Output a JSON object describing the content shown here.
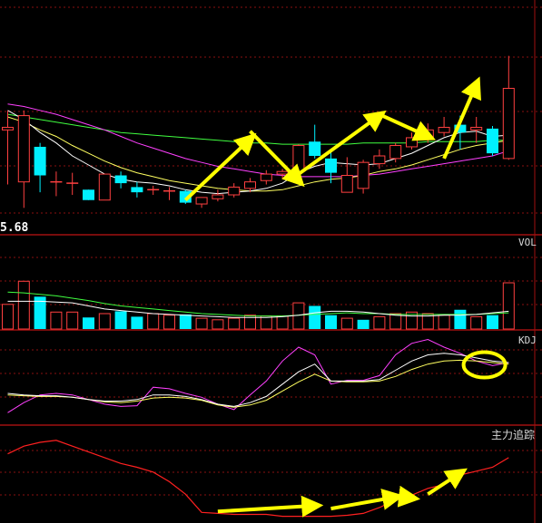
{
  "colors": {
    "background": "#000000",
    "up": "#ff4040",
    "down": "#00f0ff",
    "grid": "#8a1010",
    "divider": "#a01010",
    "ma5": "#ffffff",
    "ma10": "#ffff60",
    "ma20": "#ff40ff",
    "ma60": "#40ff40",
    "k": "#ffffff",
    "d": "#ffff60",
    "j": "#ff40ff",
    "tracker": "#ff2020",
    "arrow": "#ffff00",
    "circle": "#ffff00",
    "doji": "#ff4040"
  },
  "panels": {
    "main": {
      "price_label": "5.68"
    },
    "volume": {
      "label": "VOL"
    },
    "kdj": {
      "label": "KDJ"
    },
    "tracker": {
      "label": "主力追踪"
    }
  },
  "chart_data": [
    {
      "type": "candlestick",
      "panel": "main",
      "price_label": "5.68",
      "ylim": [
        5.4,
        7.2
      ],
      "candles": [
        {
          "o": 6.2,
          "h": 6.35,
          "l": 5.78,
          "c": 6.22,
          "dir": "up"
        },
        {
          "o": 6.31,
          "h": 6.35,
          "l": 5.6,
          "c": 5.8,
          "dir": "up"
        },
        {
          "o": 6.07,
          "h": 6.1,
          "l": 5.72,
          "c": 5.85,
          "dir": "down"
        },
        {
          "o": 5.8,
          "h": 5.88,
          "l": 5.69,
          "c": 5.8,
          "dir": "doji"
        },
        {
          "o": 5.79,
          "h": 5.87,
          "l": 5.7,
          "c": 5.79,
          "dir": "doji"
        },
        {
          "o": 5.74,
          "h": 5.74,
          "l": 5.66,
          "c": 5.66,
          "dir": "down"
        },
        {
          "o": 5.66,
          "h": 5.86,
          "l": 5.66,
          "c": 5.86,
          "dir": "up"
        },
        {
          "o": 5.85,
          "h": 5.88,
          "l": 5.75,
          "c": 5.79,
          "dir": "down"
        },
        {
          "o": 5.76,
          "h": 5.8,
          "l": 5.68,
          "c": 5.72,
          "dir": "down"
        },
        {
          "o": 5.74,
          "h": 5.77,
          "l": 5.7,
          "c": 5.74,
          "dir": "doji"
        },
        {
          "o": 5.73,
          "h": 5.76,
          "l": 5.66,
          "c": 5.7,
          "dir": "doji"
        },
        {
          "o": 5.73,
          "h": 5.74,
          "l": 5.63,
          "c": 5.64,
          "dir": "down"
        },
        {
          "o": 5.63,
          "h": 5.68,
          "l": 5.6,
          "c": 5.68,
          "dir": "up"
        },
        {
          "o": 5.67,
          "h": 5.74,
          "l": 5.65,
          "c": 5.7,
          "dir": "up"
        },
        {
          "o": 5.7,
          "h": 5.79,
          "l": 5.68,
          "c": 5.76,
          "dir": "up"
        },
        {
          "o": 5.75,
          "h": 5.83,
          "l": 5.72,
          "c": 5.8,
          "dir": "up"
        },
        {
          "o": 5.81,
          "h": 5.89,
          "l": 5.78,
          "c": 5.86,
          "dir": "up"
        },
        {
          "o": 5.86,
          "h": 5.9,
          "l": 5.82,
          "c": 5.88,
          "dir": "up"
        },
        {
          "o": 5.88,
          "h": 6.09,
          "l": 5.85,
          "c": 6.08,
          "dir": "up"
        },
        {
          "o": 6.11,
          "h": 6.24,
          "l": 5.98,
          "c": 6.0,
          "dir": "down"
        },
        {
          "o": 5.98,
          "h": 6.04,
          "l": 5.79,
          "c": 5.87,
          "dir": "down"
        },
        {
          "o": 5.85,
          "h": 5.99,
          "l": 5.72,
          "c": 5.72,
          "dir": "up"
        },
        {
          "o": 5.75,
          "h": 5.97,
          "l": 5.71,
          "c": 5.95,
          "dir": "up"
        },
        {
          "o": 5.94,
          "h": 6.05,
          "l": 5.9,
          "c": 6.0,
          "dir": "up"
        },
        {
          "o": 5.98,
          "h": 6.1,
          "l": 5.95,
          "c": 6.08,
          "dir": "up"
        },
        {
          "o": 6.07,
          "h": 6.18,
          "l": 6.05,
          "c": 6.14,
          "dir": "up"
        },
        {
          "o": 6.13,
          "h": 6.25,
          "l": 6.1,
          "c": 6.2,
          "dir": "up"
        },
        {
          "o": 6.18,
          "h": 6.3,
          "l": 6.15,
          "c": 6.22,
          "dir": "up"
        },
        {
          "o": 6.24,
          "h": 6.31,
          "l": 6.05,
          "c": 6.18,
          "dir": "down"
        },
        {
          "o": 6.22,
          "h": 6.3,
          "l": 6.1,
          "c": 6.2,
          "dir": "up"
        },
        {
          "o": 6.21,
          "h": 6.23,
          "l": 6.0,
          "c": 6.02,
          "dir": "down"
        },
        {
          "o": 5.98,
          "h": 6.77,
          "l": 5.97,
          "c": 6.52,
          "dir": "up"
        }
      ],
      "ma5": [
        6.35,
        6.28,
        6.18,
        6.1,
        6.0,
        5.93,
        5.86,
        5.82,
        5.8,
        5.79,
        5.77,
        5.74,
        5.72,
        5.71,
        5.72,
        5.73,
        5.75,
        5.79,
        5.87,
        5.92,
        5.95,
        5.94,
        5.93,
        5.94,
        5.98,
        6.02,
        6.08,
        6.14,
        6.18,
        6.19,
        6.15,
        6.16
      ],
      "ma10": [
        6.3,
        6.26,
        6.2,
        6.15,
        6.08,
        6.02,
        5.96,
        5.91,
        5.87,
        5.84,
        5.81,
        5.79,
        5.77,
        5.75,
        5.74,
        5.73,
        5.73,
        5.74,
        5.77,
        5.8,
        5.82,
        5.83,
        5.85,
        5.88,
        5.9,
        5.93,
        5.97,
        6.01,
        6.05,
        6.08,
        6.1,
        6.12
      ],
      "ma20": [
        6.4,
        6.38,
        6.35,
        6.32,
        6.28,
        6.24,
        6.2,
        6.15,
        6.1,
        6.06,
        6.02,
        5.98,
        5.95,
        5.92,
        5.9,
        5.88,
        5.86,
        5.85,
        5.84,
        5.84,
        5.84,
        5.84,
        5.85,
        5.86,
        5.88,
        5.9,
        5.92,
        5.94,
        5.96,
        5.98,
        6.0,
        6.04
      ],
      "ma60": [
        6.32,
        6.3,
        6.28,
        6.26,
        6.24,
        6.22,
        6.2,
        6.18,
        6.17,
        6.16,
        6.15,
        6.14,
        6.13,
        6.12,
        6.11,
        6.1,
        6.1,
        6.09,
        6.09,
        6.09,
        6.09,
        6.09,
        6.1,
        6.1,
        6.1,
        6.1,
        6.11,
        6.11,
        6.11,
        6.11,
        6.12,
        6.12
      ]
    },
    {
      "type": "bar",
      "panel": "volume",
      "label": "VOL",
      "ylim": [
        0,
        120
      ],
      "values": [
        32,
        62,
        42,
        22,
        22,
        15,
        20,
        23,
        16,
        20,
        18,
        19,
        14,
        12,
        14,
        18,
        17,
        17,
        34,
        30,
        18,
        14,
        12,
        16,
        20,
        22,
        20,
        18,
        25,
        16,
        18,
        60
      ],
      "dir": [
        "up",
        "up",
        "down",
        "up",
        "up",
        "down",
        "up",
        "down",
        "down",
        "up",
        "up",
        "down",
        "up",
        "up",
        "up",
        "up",
        "up",
        "up",
        "up",
        "down",
        "down",
        "up",
        "down",
        "up",
        "up",
        "up",
        "up",
        "up",
        "down",
        "up",
        "down",
        "up"
      ],
      "ma5": [
        36,
        36,
        36,
        35,
        34,
        30,
        26,
        24,
        22,
        20,
        19,
        18,
        17,
        16,
        15,
        15,
        15,
        16,
        18,
        21,
        23,
        23,
        22,
        20,
        18,
        17,
        17,
        18,
        18,
        19,
        21,
        23
      ],
      "ma10": [
        48,
        47,
        45,
        43,
        40,
        37,
        33,
        30,
        28,
        26,
        24,
        22,
        20,
        19,
        18,
        17,
        17,
        17,
        18,
        19,
        20,
        21,
        20,
        20,
        19,
        19,
        19,
        19,
        19,
        19,
        20,
        21
      ]
    },
    {
      "type": "line",
      "panel": "kdj",
      "label": "KDJ",
      "ylim": [
        -10,
        110
      ],
      "k": [
        30,
        28,
        27,
        27,
        25,
        22,
        20,
        20,
        22,
        28,
        28,
        26,
        22,
        16,
        13,
        18,
        26,
        42,
        58,
        68,
        46,
        46,
        46,
        48,
        60,
        72,
        80,
        82,
        80,
        76,
        72,
        70
      ],
      "d": [
        28,
        27,
        26,
        26,
        25,
        22,
        19,
        18,
        20,
        24,
        25,
        24,
        21,
        15,
        12,
        15,
        21,
        33,
        45,
        55,
        46,
        45,
        45,
        46,
        52,
        61,
        68,
        72,
        73,
        72,
        70,
        68
      ],
      "j": [
        5,
        18,
        28,
        30,
        28,
        22,
        16,
        13,
        14,
        38,
        36,
        30,
        25,
        16,
        9,
        28,
        46,
        72,
        90,
        80,
        42,
        47,
        47,
        53,
        80,
        95,
        100,
        90,
        82,
        72,
        66,
        70
      ]
    },
    {
      "type": "line",
      "panel": "tracker",
      "label": "主力追踪",
      "ylim": [
        -40,
        60
      ],
      "values": [
        32,
        40,
        44,
        46,
        40,
        34,
        28,
        22,
        18,
        13,
        3,
        -10,
        -29,
        -30,
        -31,
        -31,
        -31,
        -33,
        -33,
        -33,
        -33,
        -32,
        -30,
        -24,
        -16,
        -11,
        -4,
        0,
        10,
        14,
        18,
        28
      ]
    }
  ],
  "annotations": {
    "arrows": [
      {
        "panel": "main",
        "from": [
          11,
          5.66
        ],
        "to": [
          15,
          6.13
        ]
      },
      {
        "panel": "main",
        "from": [
          15,
          6.19
        ],
        "to": [
          18,
          5.81
        ]
      },
      {
        "panel": "main",
        "from": [
          18,
          5.86
        ],
        "to": [
          23,
          6.31
        ]
      },
      {
        "panel": "main",
        "from": [
          23,
          6.32
        ],
        "to": [
          26,
          6.15
        ]
      },
      {
        "panel": "main",
        "from": [
          27,
          5.98
        ],
        "to": [
          29,
          6.55
        ]
      },
      {
        "panel": "tracker",
        "from": [
          13,
          -28
        ],
        "to": [
          19,
          -22
        ]
      },
      {
        "panel": "tracker",
        "from": [
          20,
          -25
        ],
        "to": [
          24,
          -13
        ]
      },
      {
        "panel": "tracker",
        "from": [
          24,
          -12
        ],
        "to": [
          25,
          -14
        ]
      },
      {
        "panel": "tracker",
        "from": [
          26,
          -10
        ],
        "to": [
          28,
          12
        ]
      }
    ],
    "circle": {
      "panel": "kdj",
      "x": 29.5,
      "y": 67
    }
  }
}
